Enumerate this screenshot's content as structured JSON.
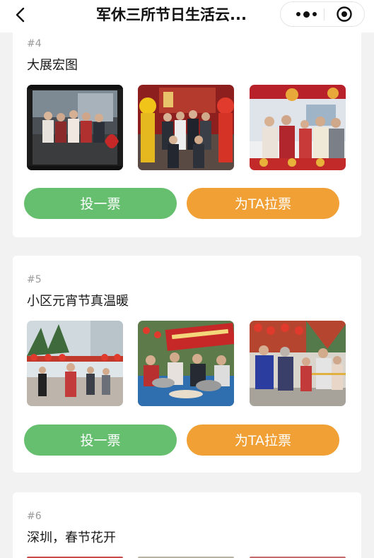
{
  "header": {
    "title": "军休三所节日生活云...",
    "back_icon": "back-chevron-icon",
    "more_icon": "more-dots-icon",
    "close_icon": "target-circle-icon"
  },
  "colors": {
    "vote_button": "#65bf6f",
    "canvass_button": "#f0a035",
    "page_bg": "#f2f2f2"
  },
  "entries": [
    {
      "number": "#4",
      "title": "大展宏图",
      "vote_label": "投一票",
      "canvass_label": "为TA拉票",
      "photos": [
        "group-photo-banner",
        "lion-dance-group-photo",
        "family-festive-photo"
      ]
    },
    {
      "number": "#5",
      "title": "小区元宵节真温暖",
      "vote_label": "投一票",
      "canvass_label": "为TA拉票",
      "photos": [
        "lantern-courtyard-photo",
        "lantern-festival-cooking-photo",
        "lantern-festival-elderly-photo"
      ]
    },
    {
      "number": "#6",
      "title": "深圳，春节花开"
    }
  ]
}
